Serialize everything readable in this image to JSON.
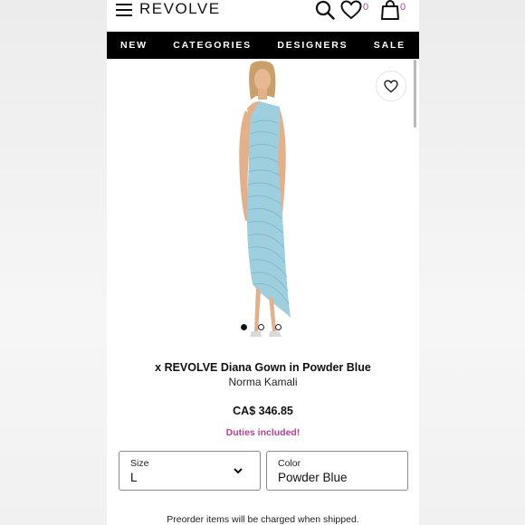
{
  "header": {
    "logo": "REVOLVE",
    "wishlist_count": "0",
    "bag_count": "0"
  },
  "nav": {
    "items": [
      "NEW",
      "CATEGORIES",
      "DESIGNERS",
      "SALE"
    ]
  },
  "carousel": {
    "total_slides": 3,
    "active_index": 0
  },
  "product": {
    "title": "x REVOLVE Diana Gown in Powder Blue",
    "designer": "Norma Kamali",
    "price": "CA$ 346.85",
    "duties_note": "Duties included!",
    "dress_color": "#9ecfdf"
  },
  "options": {
    "size_label": "Size",
    "size_value": "L",
    "color_label": "Color",
    "color_value": "Powder Blue"
  },
  "footer_note": "Preorder items will be charged when shipped.",
  "colors": {
    "accent": "#b3409a",
    "nav_bg": "#000000"
  },
  "icons": [
    "menu-icon",
    "search-icon",
    "heart-icon",
    "bag-icon",
    "chevron-down-icon"
  ]
}
